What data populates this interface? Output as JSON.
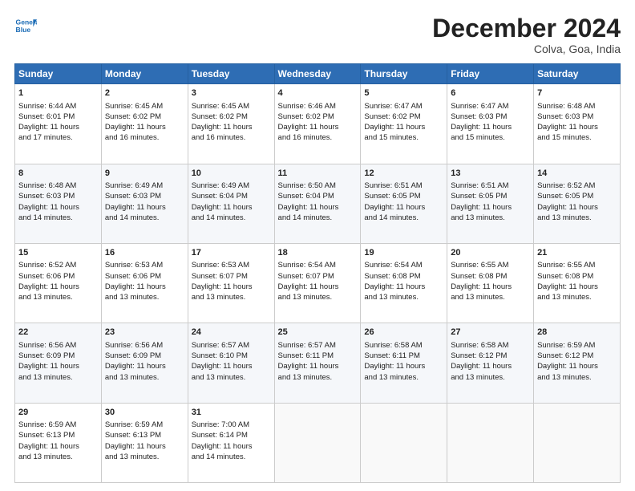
{
  "header": {
    "logo_line1": "General",
    "logo_line2": "Blue",
    "month_title": "December 2024",
    "subtitle": "Colva, Goa, India"
  },
  "days_of_week": [
    "Sunday",
    "Monday",
    "Tuesday",
    "Wednesday",
    "Thursday",
    "Friday",
    "Saturday"
  ],
  "weeks": [
    [
      {
        "day": "1",
        "lines": [
          "Sunrise: 6:44 AM",
          "Sunset: 6:01 PM",
          "Daylight: 11 hours",
          "and 17 minutes."
        ]
      },
      {
        "day": "2",
        "lines": [
          "Sunrise: 6:45 AM",
          "Sunset: 6:02 PM",
          "Daylight: 11 hours",
          "and 16 minutes."
        ]
      },
      {
        "day": "3",
        "lines": [
          "Sunrise: 6:45 AM",
          "Sunset: 6:02 PM",
          "Daylight: 11 hours",
          "and 16 minutes."
        ]
      },
      {
        "day": "4",
        "lines": [
          "Sunrise: 6:46 AM",
          "Sunset: 6:02 PM",
          "Daylight: 11 hours",
          "and 16 minutes."
        ]
      },
      {
        "day": "5",
        "lines": [
          "Sunrise: 6:47 AM",
          "Sunset: 6:02 PM",
          "Daylight: 11 hours",
          "and 15 minutes."
        ]
      },
      {
        "day": "6",
        "lines": [
          "Sunrise: 6:47 AM",
          "Sunset: 6:03 PM",
          "Daylight: 11 hours",
          "and 15 minutes."
        ]
      },
      {
        "day": "7",
        "lines": [
          "Sunrise: 6:48 AM",
          "Sunset: 6:03 PM",
          "Daylight: 11 hours",
          "and 15 minutes."
        ]
      }
    ],
    [
      {
        "day": "8",
        "lines": [
          "Sunrise: 6:48 AM",
          "Sunset: 6:03 PM",
          "Daylight: 11 hours",
          "and 14 minutes."
        ]
      },
      {
        "day": "9",
        "lines": [
          "Sunrise: 6:49 AM",
          "Sunset: 6:03 PM",
          "Daylight: 11 hours",
          "and 14 minutes."
        ]
      },
      {
        "day": "10",
        "lines": [
          "Sunrise: 6:49 AM",
          "Sunset: 6:04 PM",
          "Daylight: 11 hours",
          "and 14 minutes."
        ]
      },
      {
        "day": "11",
        "lines": [
          "Sunrise: 6:50 AM",
          "Sunset: 6:04 PM",
          "Daylight: 11 hours",
          "and 14 minutes."
        ]
      },
      {
        "day": "12",
        "lines": [
          "Sunrise: 6:51 AM",
          "Sunset: 6:05 PM",
          "Daylight: 11 hours",
          "and 14 minutes."
        ]
      },
      {
        "day": "13",
        "lines": [
          "Sunrise: 6:51 AM",
          "Sunset: 6:05 PM",
          "Daylight: 11 hours",
          "and 13 minutes."
        ]
      },
      {
        "day": "14",
        "lines": [
          "Sunrise: 6:52 AM",
          "Sunset: 6:05 PM",
          "Daylight: 11 hours",
          "and 13 minutes."
        ]
      }
    ],
    [
      {
        "day": "15",
        "lines": [
          "Sunrise: 6:52 AM",
          "Sunset: 6:06 PM",
          "Daylight: 11 hours",
          "and 13 minutes."
        ]
      },
      {
        "day": "16",
        "lines": [
          "Sunrise: 6:53 AM",
          "Sunset: 6:06 PM",
          "Daylight: 11 hours",
          "and 13 minutes."
        ]
      },
      {
        "day": "17",
        "lines": [
          "Sunrise: 6:53 AM",
          "Sunset: 6:07 PM",
          "Daylight: 11 hours",
          "and 13 minutes."
        ]
      },
      {
        "day": "18",
        "lines": [
          "Sunrise: 6:54 AM",
          "Sunset: 6:07 PM",
          "Daylight: 11 hours",
          "and 13 minutes."
        ]
      },
      {
        "day": "19",
        "lines": [
          "Sunrise: 6:54 AM",
          "Sunset: 6:08 PM",
          "Daylight: 11 hours",
          "and 13 minutes."
        ]
      },
      {
        "day": "20",
        "lines": [
          "Sunrise: 6:55 AM",
          "Sunset: 6:08 PM",
          "Daylight: 11 hours",
          "and 13 minutes."
        ]
      },
      {
        "day": "21",
        "lines": [
          "Sunrise: 6:55 AM",
          "Sunset: 6:08 PM",
          "Daylight: 11 hours",
          "and 13 minutes."
        ]
      }
    ],
    [
      {
        "day": "22",
        "lines": [
          "Sunrise: 6:56 AM",
          "Sunset: 6:09 PM",
          "Daylight: 11 hours",
          "and 13 minutes."
        ]
      },
      {
        "day": "23",
        "lines": [
          "Sunrise: 6:56 AM",
          "Sunset: 6:09 PM",
          "Daylight: 11 hours",
          "and 13 minutes."
        ]
      },
      {
        "day": "24",
        "lines": [
          "Sunrise: 6:57 AM",
          "Sunset: 6:10 PM",
          "Daylight: 11 hours",
          "and 13 minutes."
        ]
      },
      {
        "day": "25",
        "lines": [
          "Sunrise: 6:57 AM",
          "Sunset: 6:11 PM",
          "Daylight: 11 hours",
          "and 13 minutes."
        ]
      },
      {
        "day": "26",
        "lines": [
          "Sunrise: 6:58 AM",
          "Sunset: 6:11 PM",
          "Daylight: 11 hours",
          "and 13 minutes."
        ]
      },
      {
        "day": "27",
        "lines": [
          "Sunrise: 6:58 AM",
          "Sunset: 6:12 PM",
          "Daylight: 11 hours",
          "and 13 minutes."
        ]
      },
      {
        "day": "28",
        "lines": [
          "Sunrise: 6:59 AM",
          "Sunset: 6:12 PM",
          "Daylight: 11 hours",
          "and 13 minutes."
        ]
      }
    ],
    [
      {
        "day": "29",
        "lines": [
          "Sunrise: 6:59 AM",
          "Sunset: 6:13 PM",
          "Daylight: 11 hours",
          "and 13 minutes."
        ]
      },
      {
        "day": "30",
        "lines": [
          "Sunrise: 6:59 AM",
          "Sunset: 6:13 PM",
          "Daylight: 11 hours",
          "and 13 minutes."
        ]
      },
      {
        "day": "31",
        "lines": [
          "Sunrise: 7:00 AM",
          "Sunset: 6:14 PM",
          "Daylight: 11 hours",
          "and 14 minutes."
        ]
      },
      {
        "day": "",
        "lines": []
      },
      {
        "day": "",
        "lines": []
      },
      {
        "day": "",
        "lines": []
      },
      {
        "day": "",
        "lines": []
      }
    ]
  ]
}
